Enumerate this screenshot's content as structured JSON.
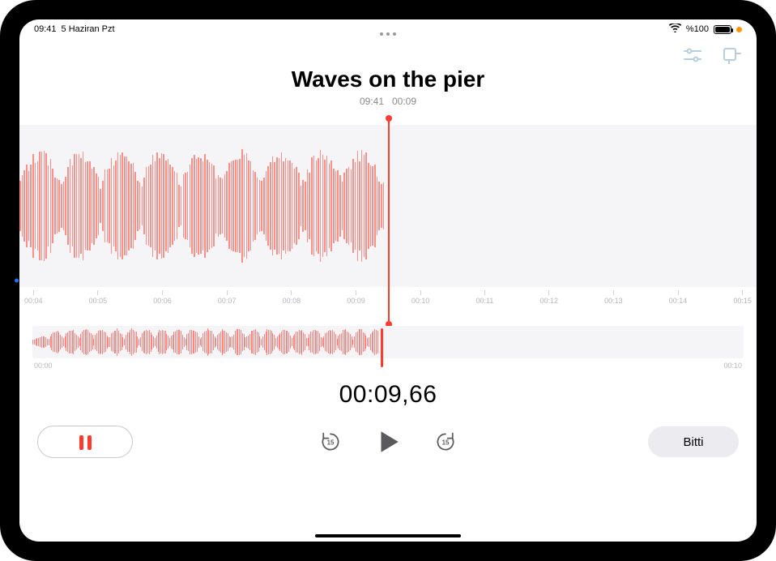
{
  "status": {
    "time": "09:41",
    "date": "5 Haziran Pzt",
    "battery_pct": "%100"
  },
  "toolbar": {
    "settings_icon": "playback-settings-icon",
    "trim_icon": "trim-icon"
  },
  "recording": {
    "title": "Waves on the pier",
    "meta_time": "09:41",
    "meta_duration": "00:09"
  },
  "ruler_ticks": [
    "00:04",
    "00:05",
    "00:06",
    "00:07",
    "00:08",
    "00:09",
    "00:10",
    "00:11",
    "00:12",
    "00:13",
    "00:14",
    "00:15"
  ],
  "mini": {
    "start": "00:00",
    "end": "00:10"
  },
  "playback": {
    "current_time": "00:09,66"
  },
  "controls": {
    "pause_label": "Pause",
    "skip_back_label": "Back 15",
    "play_label": "Play",
    "skip_fwd_label": "Forward 15",
    "done_label": "Bitti"
  }
}
